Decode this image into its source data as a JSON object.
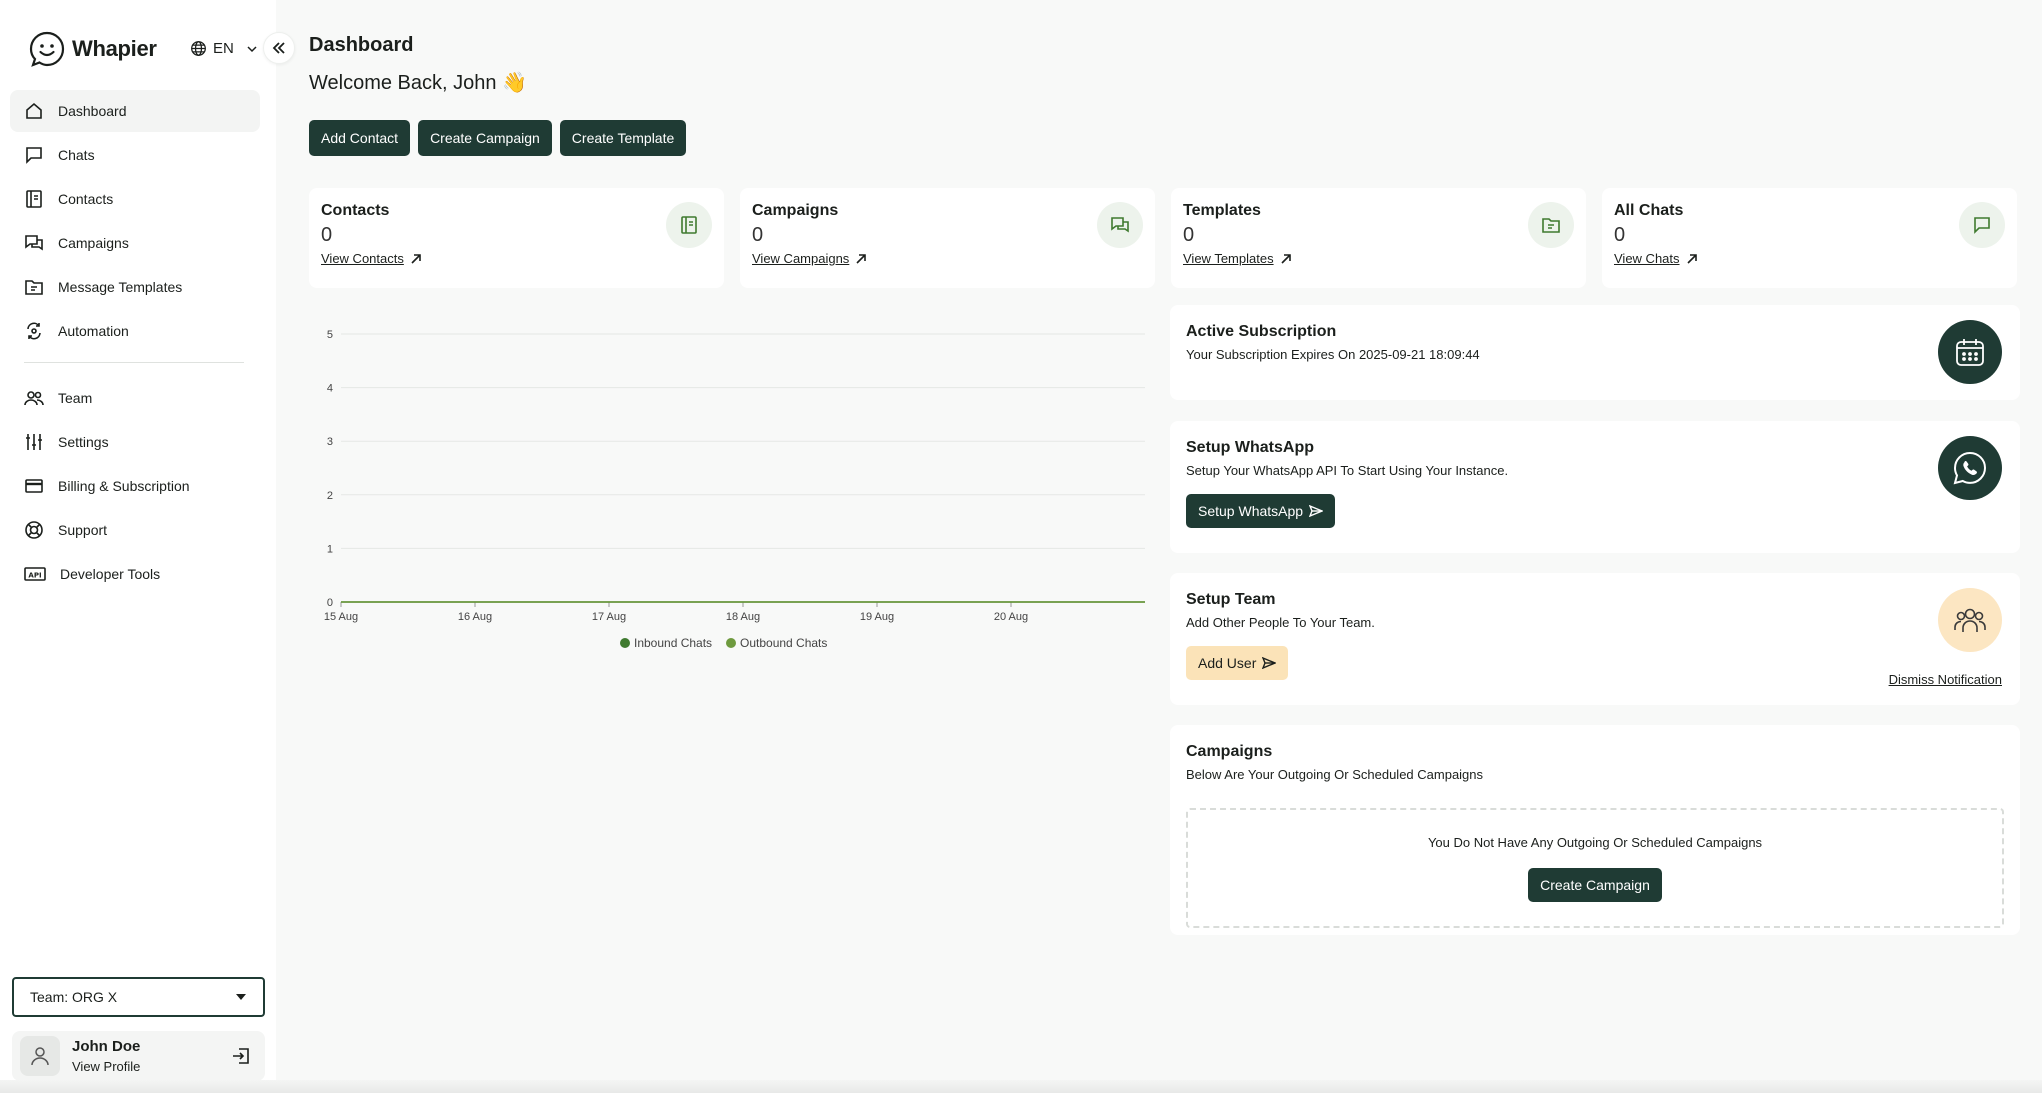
{
  "brand": {
    "name": "Whapier"
  },
  "language": {
    "code": "EN"
  },
  "sidebar": {
    "items": [
      {
        "label": "Dashboard",
        "icon": "home-icon",
        "active": true
      },
      {
        "label": "Chats",
        "icon": "chat-icon"
      },
      {
        "label": "Contacts",
        "icon": "contacts-icon"
      },
      {
        "label": "Campaigns",
        "icon": "campaigns-icon"
      },
      {
        "label": "Message Templates",
        "icon": "template-icon"
      },
      {
        "label": "Automation",
        "icon": "automation-icon"
      },
      {
        "label": "Team",
        "icon": "team-icon"
      },
      {
        "label": "Settings",
        "icon": "sliders-icon"
      },
      {
        "label": "Billing & Subscription",
        "icon": "card-icon"
      },
      {
        "label": "Support",
        "icon": "lifebuoy-icon"
      },
      {
        "label": "Developer Tools",
        "icon": "api-icon"
      }
    ],
    "team_select": "Team: ORG X",
    "profile": {
      "name": "John Doe",
      "link": "View Profile"
    }
  },
  "header": {
    "title": "Dashboard",
    "welcome": "Welcome Back, John",
    "wave": "👋"
  },
  "actions": {
    "add_contact": "Add Contact",
    "create_campaign": "Create Campaign",
    "create_template": "Create Template"
  },
  "stats": [
    {
      "title": "Contacts",
      "value": "0",
      "link": "View Contacts"
    },
    {
      "title": "Campaigns",
      "value": "0",
      "link": "View Campaigns"
    },
    {
      "title": "Templates",
      "value": "0",
      "link": "View Templates"
    },
    {
      "title": "All Chats",
      "value": "0",
      "link": "View Chats"
    }
  ],
  "subscription": {
    "title": "Active Subscription",
    "text": "Your Subscription Expires On 2025-09-21 18:09:44"
  },
  "whatsapp": {
    "title": "Setup WhatsApp",
    "text": "Setup Your WhatsApp API To Start Using Your Instance.",
    "button": "Setup WhatsApp"
  },
  "team_setup": {
    "title": "Setup Team",
    "text": "Add Other People To Your Team.",
    "button": "Add User",
    "dismiss": "Dismiss Notification"
  },
  "campaigns_panel": {
    "title": "Campaigns",
    "text": "Below Are Your Outgoing Or Scheduled Campaigns",
    "empty": "You Do Not Have Any Outgoing Or Scheduled Campaigns",
    "button": "Create Campaign"
  },
  "colors": {
    "primary": "#1f3b34",
    "accent_light": "#edf3ec",
    "amber": "#fbe3b8",
    "series_inbound": "#3f7a2f",
    "series_outbound": "#6e9a3e"
  },
  "chart_data": {
    "type": "line",
    "x": [
      "15 Aug",
      "16 Aug",
      "17 Aug",
      "18 Aug",
      "19 Aug",
      "20 Aug"
    ],
    "series": [
      {
        "name": "Inbound Chats",
        "values": [
          0,
          0,
          0,
          0,
          0,
          0
        ]
      },
      {
        "name": "Outbound Chats",
        "values": [
          0,
          0,
          0,
          0,
          0,
          0
        ]
      }
    ],
    "yticks": [
      "0",
      "1",
      "2",
      "3",
      "4",
      "5"
    ],
    "ylim": [
      0,
      5
    ],
    "grid": true,
    "legend": "bottom"
  }
}
